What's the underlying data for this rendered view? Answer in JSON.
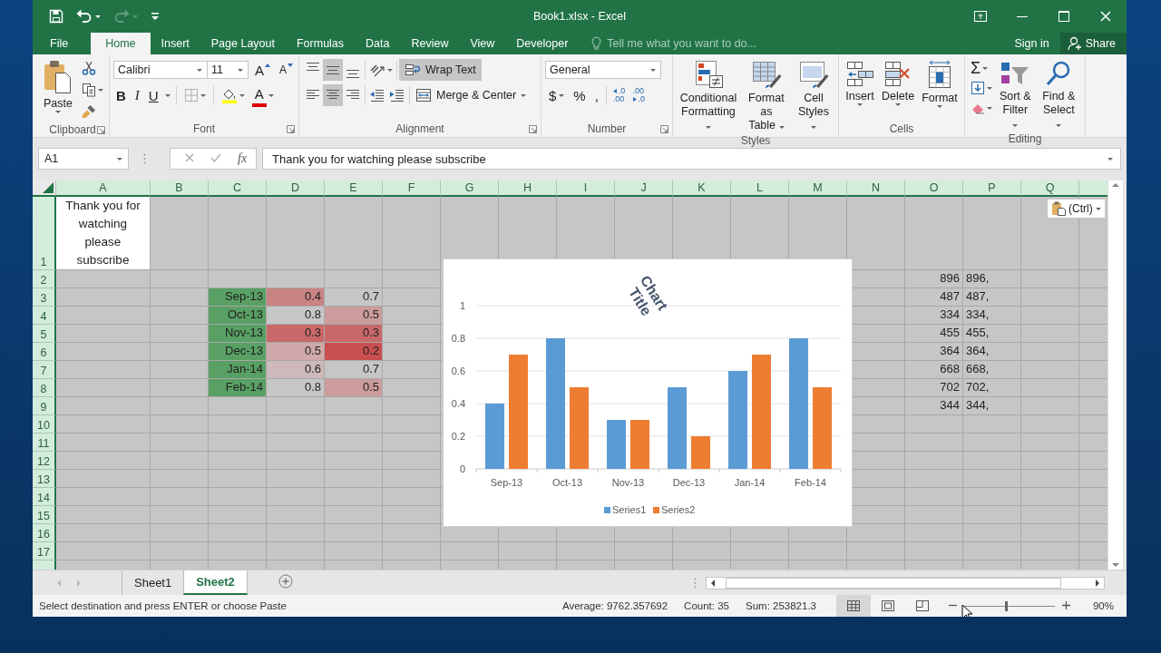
{
  "window": {
    "title": "Book1.xlsx - Excel"
  },
  "quick_access": [
    {
      "kind": "save",
      "disabled": false
    },
    {
      "kind": "undo",
      "disabled": false
    },
    {
      "kind": "redo",
      "disabled": true
    },
    {
      "kind": "customize",
      "disabled": false
    }
  ],
  "tabs": [
    {
      "label": "File",
      "selected": false
    },
    {
      "label": "Home",
      "selected": true
    },
    {
      "label": "Insert",
      "selected": false
    },
    {
      "label": "Page Layout",
      "selected": false
    },
    {
      "label": "Formulas",
      "selected": false
    },
    {
      "label": "Data",
      "selected": false
    },
    {
      "label": "Review",
      "selected": false
    },
    {
      "label": "View",
      "selected": false
    },
    {
      "label": "Developer",
      "selected": false
    }
  ],
  "tell_me": {
    "placeholder": "Tell me what you want to do..."
  },
  "account": {
    "sign_in": "Sign in",
    "share": "Share"
  },
  "ribbon": {
    "clipboard": {
      "label": "Clipboard",
      "paste": "Paste"
    },
    "font": {
      "label": "Font",
      "font_name": "Calibri",
      "font_size": "11",
      "grow": "A",
      "shrink": "A",
      "bold": "B",
      "italic": "I",
      "underline": "U",
      "font_color": "A"
    },
    "alignment": {
      "label": "Alignment",
      "buttons": [
        {
          "kind": "top",
          "selected": false
        },
        {
          "kind": "middle",
          "selected": true
        },
        {
          "kind": "bottom",
          "selected": false
        },
        {
          "kind": "left",
          "selected": false
        },
        {
          "kind": "center",
          "selected": true
        },
        {
          "kind": "right",
          "selected": false
        }
      ],
      "wrap_text": {
        "label": "Wrap Text",
        "selected": true
      },
      "merge": "Merge & Center"
    },
    "number": {
      "label": "Number",
      "format": "General",
      "currency": "$",
      "percent": "%",
      "comma": ",",
      "decimals": [
        {
          "kind": "increase",
          "top": ".0",
          "bottom": ".00"
        },
        {
          "kind": "decrease",
          "top": ".00",
          "bottom": ".0"
        }
      ]
    },
    "styles": {
      "label": "Styles",
      "buttons": [
        {
          "kind": "conditional",
          "line1": "Conditional",
          "line2": "Formatting"
        },
        {
          "kind": "table",
          "line1": "Format as",
          "line2": "Table"
        },
        {
          "kind": "cell_styles",
          "line1": "Cell",
          "line2": "Styles"
        }
      ]
    },
    "cells": {
      "label": "Cells",
      "buttons": [
        {
          "kind": "insert",
          "label": "Insert"
        },
        {
          "kind": "delete",
          "label": "Delete"
        },
        {
          "kind": "format",
          "label": "Format"
        }
      ]
    },
    "editing": {
      "label": "Editing",
      "autosum": "Σ",
      "buttons": [
        {
          "kind": "sort",
          "line1": "Sort &",
          "line2": "Filter"
        },
        {
          "kind": "find",
          "line1": "Find &",
          "line2": "Select"
        }
      ]
    }
  },
  "formula_bar": {
    "name_box": "A1",
    "function_glyph": "fx",
    "formula": "Thank you for watching please subscribe"
  },
  "sheet": {
    "columns": [
      "A",
      "B",
      "C",
      "D",
      "E",
      "F",
      "G",
      "H",
      "I",
      "J",
      "K",
      "L",
      "M",
      "N",
      "O",
      "P",
      "Q"
    ],
    "rows": [
      {
        "header": "1",
        "cells": {
          "A": {
            "text": "Thank you for watching please subscribe",
            "kind": "wrapped",
            "active": true
          }
        }
      },
      {
        "header": "2",
        "cells": {
          "O": {
            "text": "896",
            "kind": "number"
          },
          "P": {
            "text": "896,",
            "kind": "text"
          }
        }
      },
      {
        "header": "3",
        "cells": {
          "C": {
            "text": "Sep-13",
            "kind": "number",
            "color": "#59a064"
          },
          "D": {
            "text": "0.4",
            "kind": "number",
            "color": "#c98383"
          },
          "E": {
            "text": "0.7",
            "kind": "number"
          },
          "O": {
            "text": "487",
            "kind": "number"
          },
          "P": {
            "text": "487,",
            "kind": "text"
          }
        }
      },
      {
        "header": "4",
        "cells": {
          "C": {
            "text": "Oct-13",
            "kind": "number",
            "color": "#59a064"
          },
          "D": {
            "text": "0.8",
            "kind": "number"
          },
          "E": {
            "text": "0.5",
            "kind": "number",
            "color": "#cc9c9c"
          },
          "O": {
            "text": "334",
            "kind": "number"
          },
          "P": {
            "text": "334,",
            "kind": "text"
          }
        }
      },
      {
        "header": "5",
        "cells": {
          "C": {
            "text": "Nov-13",
            "kind": "number",
            "color": "#59a064"
          },
          "D": {
            "text": "0.3",
            "kind": "number",
            "color": "#c96868"
          },
          "E": {
            "text": "0.3",
            "kind": "number",
            "color": "#c96868"
          },
          "O": {
            "text": "455",
            "kind": "number"
          },
          "P": {
            "text": "455,",
            "kind": "text"
          }
        }
      },
      {
        "header": "6",
        "cells": {
          "C": {
            "text": "Dec-13",
            "kind": "number",
            "color": "#59a064"
          },
          "D": {
            "text": "0.5",
            "kind": "number",
            "color": "#cfa9a9"
          },
          "E": {
            "text": "0.2",
            "kind": "number",
            "color": "#c94f4f"
          },
          "O": {
            "text": "364",
            "kind": "number"
          },
          "P": {
            "text": "364,",
            "kind": "text"
          }
        }
      },
      {
        "header": "7",
        "cells": {
          "C": {
            "text": "Jan-14",
            "kind": "number",
            "color": "#59a064"
          },
          "D": {
            "text": "0.6",
            "kind": "number",
            "color": "#cdb9b9"
          },
          "E": {
            "text": "0.7",
            "kind": "number"
          },
          "O": {
            "text": "668",
            "kind": "number"
          },
          "P": {
            "text": "668,",
            "kind": "text"
          }
        }
      },
      {
        "header": "8",
        "cells": {
          "C": {
            "text": "Feb-14",
            "kind": "number",
            "color": "#59a064"
          },
          "D": {
            "text": "0.8",
            "kind": "number"
          },
          "E": {
            "text": "0.5",
            "kind": "number",
            "color": "#cc9c9c"
          },
          "O": {
            "text": "702",
            "kind": "number"
          },
          "P": {
            "text": "702,",
            "kind": "text"
          }
        }
      },
      {
        "header": "9",
        "cells": {
          "O": {
            "text": "344",
            "kind": "number"
          },
          "P": {
            "text": "344,",
            "kind": "text"
          }
        }
      },
      {
        "header": "10"
      },
      {
        "header": "11"
      },
      {
        "header": "12"
      },
      {
        "header": "13"
      },
      {
        "header": "14"
      },
      {
        "header": "15"
      },
      {
        "header": "16"
      },
      {
        "header": "17"
      }
    ]
  },
  "paste_options": "(Ctrl)",
  "chart": {
    "chart_data": {
      "type": "bar",
      "title": "Chart Title",
      "categories": [
        "Sep-13",
        "Oct-13",
        "Nov-13",
        "Dec-13",
        "Jan-14",
        "Feb-14"
      ],
      "series": [
        {
          "name": "Series1",
          "color": "#5b9bd5",
          "values": [
            0.4,
            0.8,
            0.3,
            0.5,
            0.6,
            0.8
          ]
        },
        {
          "name": "Series2",
          "color": "#ed7d31",
          "values": [
            0.7,
            0.5,
            0.3,
            0.2,
            0.7,
            0.5
          ]
        }
      ],
      "grid": true,
      "legend": "bottom",
      "ylim": [
        0,
        1
      ],
      "yticks": [
        {
          "value": 0,
          "label": "0"
        },
        {
          "value": 0.2,
          "label": "0.2"
        },
        {
          "value": 0.4,
          "label": "0.4"
        },
        {
          "value": 0.6,
          "label": "0.6"
        },
        {
          "value": 0.8,
          "label": "0.8"
        },
        {
          "value": 1,
          "label": "1"
        }
      ]
    }
  },
  "sheet_tabs": [
    {
      "label": "Sheet1",
      "selected": false
    },
    {
      "label": "Sheet2",
      "selected": true
    }
  ],
  "status_bar": {
    "message": "Select destination and press ENTER or choose Paste",
    "average": "Average: 9762.357692",
    "count": "Count: 35",
    "sum": "Sum: 253821.3",
    "views": [
      {
        "kind": "normal",
        "selected": true
      },
      {
        "kind": "page_layout",
        "selected": false
      },
      {
        "kind": "page_break",
        "selected": false
      }
    ],
    "zoom": {
      "level": 0.46,
      "reading": "90%"
    }
  }
}
